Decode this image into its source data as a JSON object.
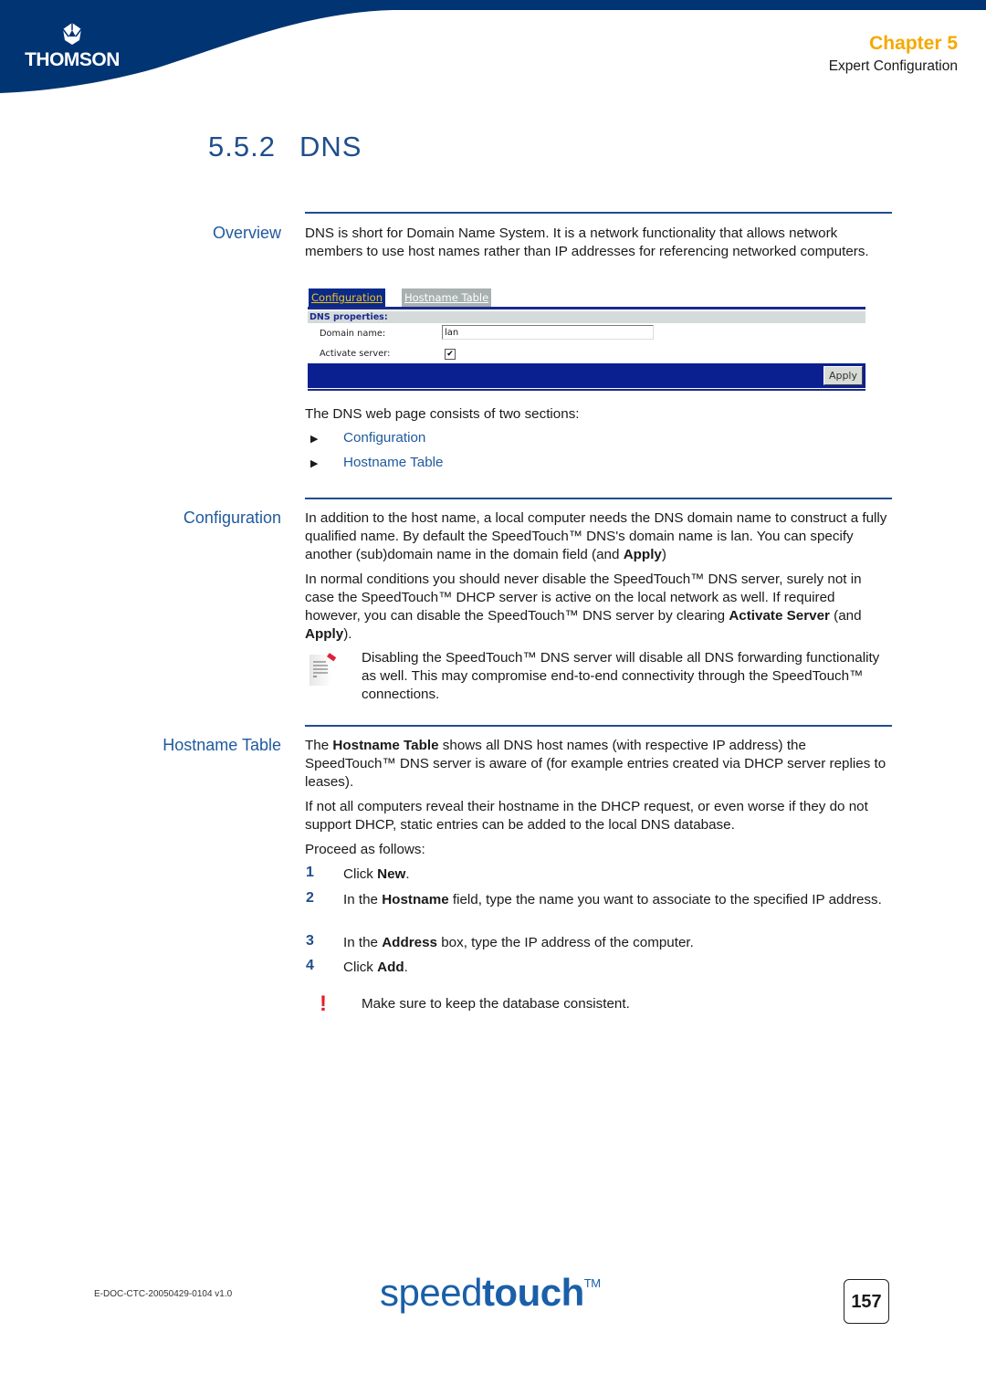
{
  "header": {
    "brand": "THOMSON",
    "chapter": "Chapter 5",
    "chapter_subtitle": "Expert Configuration",
    "colors": {
      "brand_blue": "#003473",
      "chapter_orange": "#f6a800",
      "heading_blue": "#1f4e8c"
    }
  },
  "section": {
    "number": "5.5.2",
    "title": "DNS"
  },
  "overview": {
    "label": "Overview",
    "text": "DNS is short for Domain Name System. It is a network functionality that allows network members to use host names rather than IP addresses for referencing networked computers.",
    "webui": {
      "tabs": [
        "Configuration",
        "Hostname Table"
      ],
      "section_title": "DNS properties:",
      "domain_label": "Domain name:",
      "domain_value": "lan",
      "activate_label": "Activate server:",
      "activate_checked": true,
      "checkmark": "✔",
      "apply_label": "Apply"
    },
    "sections_intro": "The DNS web page consists of two sections:",
    "sections": [
      "Configuration",
      "Hostname Table"
    ],
    "bullet_icon": "▶"
  },
  "configuration": {
    "label": "Configuration",
    "p1_a": "In addition to the host name, a local computer needs the DNS domain name to construct a fully qualified name. By default the SpeedTouch™ DNS's domain name is lan. You can specify another (sub)domain name in the domain field (and ",
    "p1_b": "Apply",
    "p1_c": ")",
    "p2_a": "In normal conditions you should never disable the SpeedTouch™ DNS server, surely not in case the SpeedTouch™ DHCP server is active on the local network as well. If required however, you can disable the SpeedTouch™ DNS server by clearing ",
    "p2_b": "Activate Server",
    "p2_c": " (and ",
    "p2_d": "Apply",
    "p2_e": ").",
    "note": "Disabling the SpeedTouch™ DNS server will disable all DNS forwarding functionality as well. This may compromise end-to-end connectivity through the SpeedTouch™ connections."
  },
  "hostname_table": {
    "label": "Hostname Table",
    "p1_a": "The ",
    "p1_b": "Hostname Table",
    "p1_c": " shows all DNS host names (with respective IP address) the SpeedTouch™ DNS server is aware of (for example entries created via DHCP server replies to leases).",
    "p2": "If not all computers reveal their hostname in the DHCP request, or even worse if they do not support DHCP, static entries can be added to the local DNS database.",
    "p3": "Proceed as follows:",
    "steps": [
      {
        "num": "1",
        "a": "Click ",
        "b": "New",
        "c": "."
      },
      {
        "num": "2",
        "a": "In the ",
        "b": "Hostname",
        "c": " field, type the name you want to associate to the specified IP address."
      },
      {
        "num": "3",
        "a": "In the ",
        "b": "Address",
        "c": " box, type the IP address of the computer."
      },
      {
        "num": "4",
        "a": "Click ",
        "b": "Add",
        "c": "."
      }
    ],
    "warning_icon": "!",
    "warning": "Make sure to keep the database consistent."
  },
  "footer": {
    "doc_id": "E-DOC-CTC-20050429-0104 v1.0",
    "logo_light": "speed",
    "logo_bold": "touch",
    "logo_tm": "TM",
    "page_number": "157"
  }
}
